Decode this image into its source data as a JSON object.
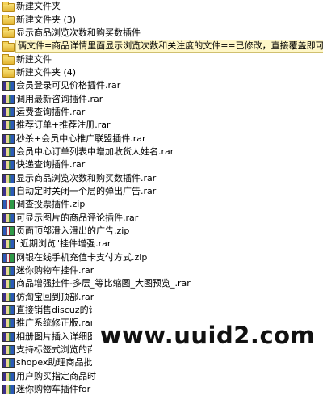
{
  "explorer": {
    "items": [
      {
        "label": "新建文件夹",
        "icon": "folder-icon"
      },
      {
        "label": "新建文件夹 (3)",
        "icon": "folder-icon"
      },
      {
        "label": "显示商品浏览次数和购买数插件",
        "icon": "folder-icon"
      },
      {
        "label": "俩文件=商品详情里面显示浏览次数和关注度的文件==已修改，直接覆盖即可",
        "icon": "folder-icon",
        "selected": true
      },
      {
        "label": "新建文件",
        "icon": "folder-icon"
      },
      {
        "label": "新建文件夹 (4)",
        "icon": "folder-icon"
      },
      {
        "label": "会员登录可见价格插件.rar",
        "icon": "rar-archive-icon"
      },
      {
        "label": "调用最新咨询插件.rar",
        "icon": "rar-archive-icon"
      },
      {
        "label": "运费查询插件.rar",
        "icon": "rar-archive-icon"
      },
      {
        "label": "推荐订单+推荐注册.rar",
        "icon": "rar-archive-icon"
      },
      {
        "label": "秒杀+会员中心推广联盟插件.rar",
        "icon": "rar-archive-icon"
      },
      {
        "label": "会员中心订单列表中增加收货人姓名.rar",
        "icon": "rar-archive-icon"
      },
      {
        "label": "快递查询插件.rar",
        "icon": "rar-archive-icon"
      },
      {
        "label": "显示商品浏览次数和购买数插件.rar",
        "icon": "rar-archive-icon"
      },
      {
        "label": "自动定时关闭一个层的弹出广告.rar",
        "icon": "rar-archive-icon"
      },
      {
        "label": "调查投票插件.zip",
        "icon": "zip-archive-icon"
      },
      {
        "label": "可显示图片的商品评论插件.rar",
        "icon": "rar-archive-icon"
      },
      {
        "label": "页面顶部滑入滑出的广告.zip",
        "icon": "zip-archive-icon"
      },
      {
        "label": "\"近期浏览\"挂件增强.rar",
        "icon": "rar-archive-icon"
      },
      {
        "label": "网银在线手机充值卡支付方式.zip",
        "icon": "zip-archive-icon"
      },
      {
        "label": "迷你购物车挂件.rar",
        "icon": "rar-archive-icon"
      },
      {
        "label": "商品增强挂件-多层_等比缩图_大图预览_.rar",
        "icon": "rar-archive-icon"
      },
      {
        "label": "仿淘宝回到顶部.rar",
        "icon": "rar-archive-icon"
      },
      {
        "label": "直接销售discuz的论坛积分.rar",
        "icon": "rar-archive-icon"
      },
      {
        "label": "推广系统修正版.rar",
        "icon": "rar-archive-icon"
      },
      {
        "label": "相册图片插入详细图",
        "icon": "rar-archive-icon"
      },
      {
        "label": "支持标签式浏览的商",
        "icon": "rar-archive-icon"
      },
      {
        "label": "shopex助理商品批量",
        "icon": "rar-archive-icon"
      },
      {
        "label": "用户购买指定商品时",
        "icon": "rar-archive-icon"
      },
      {
        "label": "迷你购物车插件for",
        "icon": "rar-archive-icon"
      }
    ]
  },
  "watermark": {
    "text": "www.uuid2.com"
  }
}
